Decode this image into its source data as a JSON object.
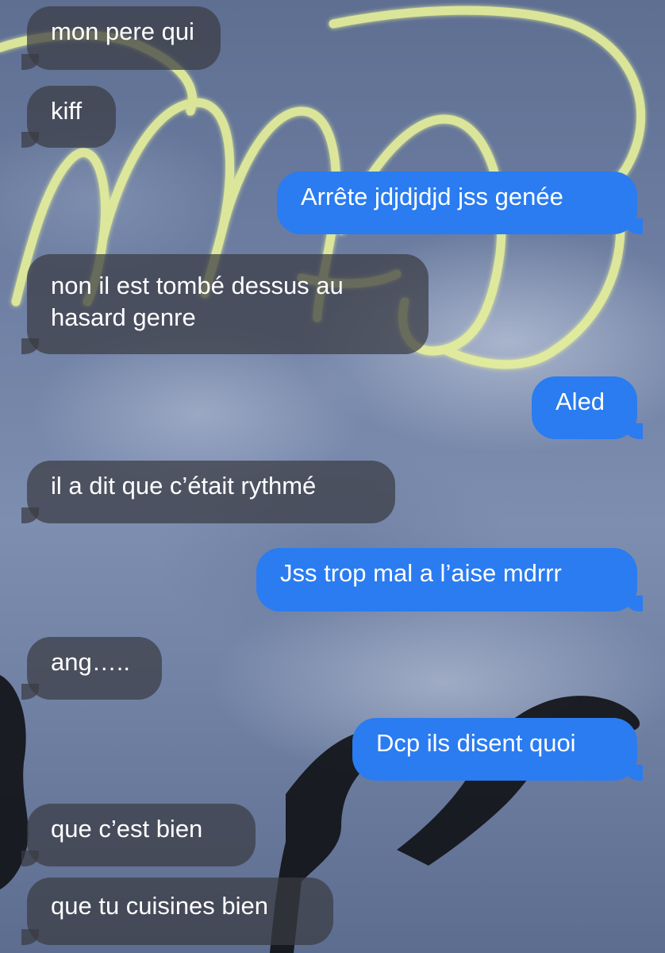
{
  "conversation": {
    "messages": [
      {
        "direction": "received",
        "text": "mon pere qui"
      },
      {
        "direction": "received",
        "text": "kiff"
      },
      {
        "direction": "sent",
        "text": "Arrête jdjdjdjd jss genée"
      },
      {
        "direction": "received",
        "text": "non il est tombé dessus au hasard genre"
      },
      {
        "direction": "sent",
        "text": "Aled"
      },
      {
        "direction": "received",
        "text": "il a dit que c’était rythmé"
      },
      {
        "direction": "sent",
        "text": "Jss trop mal a l’aise mdrrr"
      },
      {
        "direction": "received",
        "text": "ang….."
      },
      {
        "direction": "sent",
        "text": "Dcp ils disent quoi"
      },
      {
        "direction": "received",
        "text": "que c’est bien"
      },
      {
        "direction": "received",
        "text": "que tu cuisines bien"
      }
    ]
  },
  "colors": {
    "sent_bubble": "#2a7cf0",
    "received_bubble": "#3a3c42",
    "neon_scribble": "#e8f29a",
    "wallpaper_sky": "#6e7fa3"
  }
}
